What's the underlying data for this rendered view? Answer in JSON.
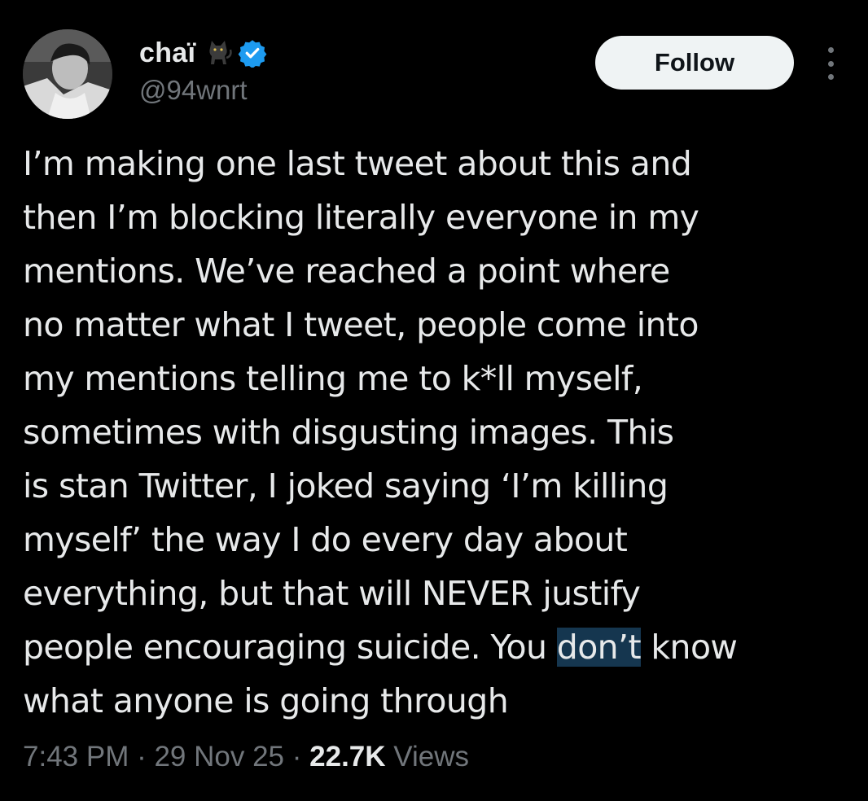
{
  "user": {
    "display_name": "chaï",
    "handle": "@94wnrt",
    "cat_emoji_icon": "cat-emoji-icon",
    "verified_icon": "verified-badge-icon",
    "verified_color": "#1d9bf0"
  },
  "actions": {
    "follow_label": "Follow",
    "more_icon": "more-options-icon"
  },
  "tweet": {
    "lines": [
      "I’m making one last tweet about this and",
      "then I’m blocking literally everyone in my",
      "mentions. We’ve reached a point where",
      "no matter what I tweet, people come into",
      "my mentions telling me to k*ll myself,",
      "sometimes with disgusting images. This",
      "is stan Twitter, I joked saying ‘I’m killing",
      "myself’ the way I do every day about",
      "everything, but that will NEVER justify"
    ],
    "line10_before": "people encouraging suicide. You ",
    "line10_highlight": "don’t",
    "line10_after": " know",
    "line11": "what anyone is going through",
    "highlight_color": "#15364f"
  },
  "meta": {
    "time": "7:43 PM",
    "separator": " · ",
    "date": "29 Nov 25",
    "views_count": "22.7K",
    "views_label": " Views"
  },
  "colors": {
    "background": "#000000",
    "text": "#e7e9ea",
    "secondary": "#71767b"
  }
}
